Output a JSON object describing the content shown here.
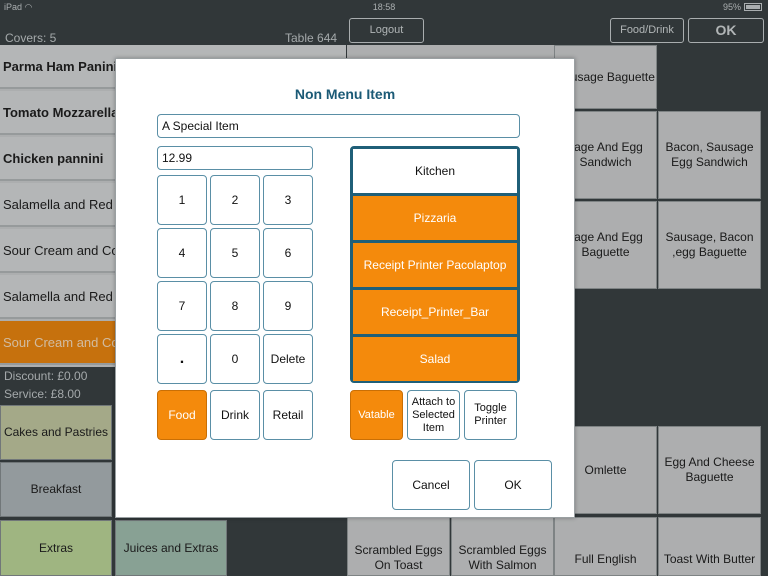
{
  "status": {
    "device": "iPad",
    "time": "18:58",
    "battery": "95%"
  },
  "header": {
    "covers": "Covers: 5",
    "table": "Table  644",
    "logout": "Logout",
    "food_drink": "Food/Drink",
    "ok": "OK"
  },
  "order": {
    "items": [
      "Parma Ham Panini",
      "Tomato Mozzarella",
      "Chicken pannini",
      "Salamella and Red",
      "Sour Cream and Co",
      "Salamella and Red",
      "Sour Cream and Co"
    ],
    "discount": "Discount: £0.00",
    "service": "Service: £8.00"
  },
  "categories": [
    "Cakes and Pastries",
    "Breakfast",
    "Extras",
    "Juices and Extras"
  ],
  "products": {
    "p1": "Sausage Baguette",
    "p2": "sage And Egg Sandwich",
    "p3": "Bacon, Sausage Egg Sandwich",
    "p4": "sage And Egg Baguette",
    "p5": "Sausage, Bacon ,egg Baguette",
    "p6": "Omlette",
    "p7": "Egg And Cheese Baguette",
    "p8": "Scrambled Eggs On Toast",
    "p9": "Scrambled Eggs With Salmon",
    "p10": "Full English",
    "p11": "Toast With Butter"
  },
  "dialog": {
    "title": "Non Menu Item",
    "description": "A Special Item",
    "price": "12.99",
    "keys": [
      "1",
      "2",
      "3",
      "4",
      "5",
      "6",
      "7",
      "8",
      "9",
      ".",
      "0",
      "Delete"
    ],
    "types": {
      "food": "Food",
      "drink": "Drink",
      "retail": "Retail"
    },
    "printers": [
      "Kitchen",
      "Pizzaria",
      "Receipt Printer Pacolaptop",
      "Receipt_Printer_Bar",
      "Salad"
    ],
    "vatable": "Vatable",
    "attach": "Attach to Selected Item",
    "toggle": "Toggle Printer",
    "cancel": "Cancel",
    "ok": "OK"
  },
  "colors": {
    "accent": "#f48a0c",
    "title": "#1b5a76",
    "background": "#3c4446"
  }
}
